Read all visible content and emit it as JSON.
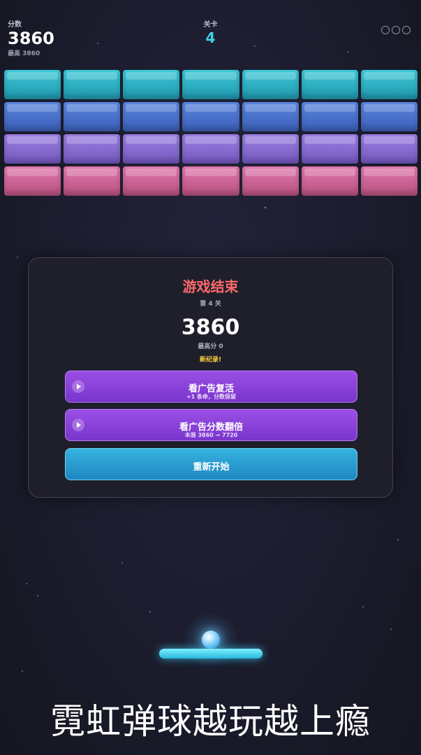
{
  "hud": {
    "score_label": "分数",
    "score": "3860",
    "best": "最高 3860",
    "level_label": "关卡",
    "level": "4",
    "lives": 3
  },
  "bricks": {
    "rows": [
      {
        "color": "teal",
        "count": 7
      },
      {
        "color": "blue",
        "count": 7
      },
      {
        "color": "purple",
        "count": 7
      },
      {
        "color": "pink",
        "count": 7
      }
    ],
    "colors": {
      "teal": "#2fb4c6",
      "blue": "#4a73cc",
      "purple": "#866bd0",
      "pink": "#cc6595"
    }
  },
  "dialog": {
    "title": "游戏结束",
    "level_text": "第 4 关",
    "score": "3860",
    "best": "最高分  0",
    "record": "新纪录!",
    "revive_button": {
      "label": "看广告复活",
      "sub": "+1 条命，分数保留",
      "icon": "play-icon"
    },
    "double_button": {
      "label": "看广告分数翻倍",
      "sub": "本局 3860 → 7720",
      "icon": "play-icon"
    },
    "restart_button": {
      "label": "重新开始"
    }
  },
  "slogan": "霓虹弹球越玩越上瘾",
  "accent_colors": {
    "title_red": "#ff6a6a",
    "record_yellow": "#ffd23a",
    "level_cyan": "#3fd0e6",
    "ad_purple": "#8a42da",
    "restart_blue": "#2a9dd0"
  }
}
